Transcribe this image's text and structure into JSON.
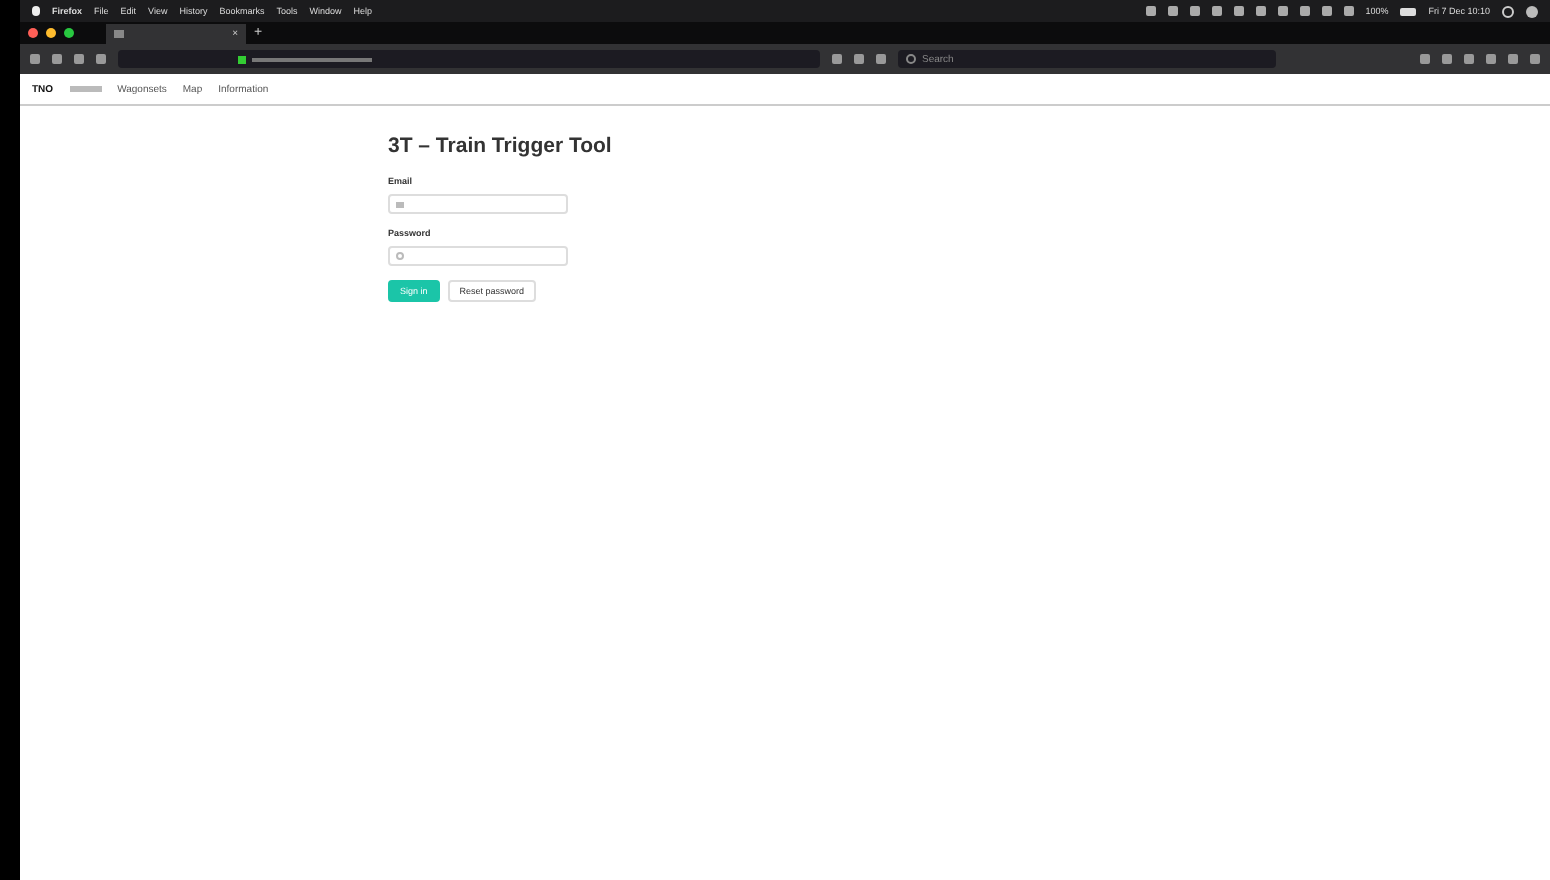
{
  "menu_bar": {
    "app": "Firefox",
    "items": [
      "File",
      "Edit",
      "View",
      "History",
      "Bookmarks",
      "Tools",
      "Window",
      "Help"
    ],
    "battery": "100%",
    "clock": "Fri 7 Dec 10:10"
  },
  "browser": {
    "tab_close": "×",
    "new_tab": "+",
    "search": {
      "placeholder": "Search"
    }
  },
  "site_nav": {
    "logo": "TNO",
    "items": [
      {
        "label": "Wagonsets",
        "selected": false
      },
      {
        "label": "Map",
        "selected": false
      },
      {
        "label": "Information",
        "selected": false
      }
    ]
  },
  "login": {
    "title": "3T – Train Trigger Tool",
    "fields": [
      {
        "label": "Email",
        "kind": "email"
      },
      {
        "label": "Password",
        "kind": "password"
      }
    ],
    "buttons": [
      {
        "label": "Sign in",
        "kind": "primary"
      },
      {
        "label": "Reset password",
        "kind": "secondary"
      }
    ]
  }
}
